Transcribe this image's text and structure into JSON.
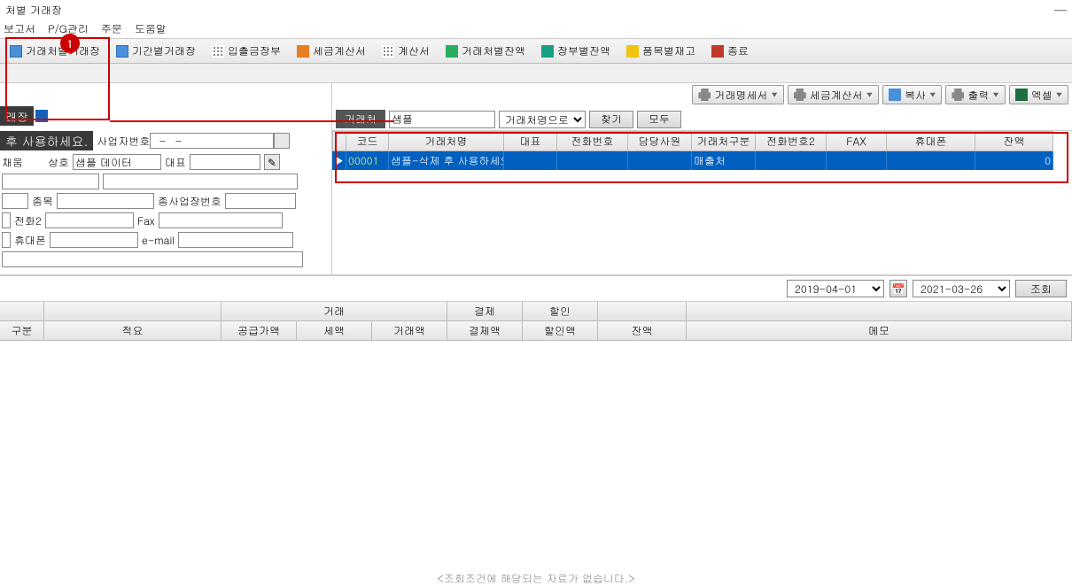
{
  "window": {
    "title": "처별 거래장",
    "minimize": "—"
  },
  "menu": {
    "report": "보고서",
    "pg": "P/G관리",
    "order": "주문",
    "help": "도움말"
  },
  "toolbar": {
    "btn1": "거래처별거래장",
    "btn2": "기간별거래장",
    "btn3": "입출금장부",
    "btn4": "세금계산서",
    "btn5": "계산서",
    "btn6": "거래처별잔액",
    "btn7": "장부별잔액",
    "btn8": "품목별재고",
    "btn9": "종료"
  },
  "badge": "1",
  "left": {
    "tab": "래장",
    "hint": "후 사용하세요.",
    "lbl_bizno": "사업자번호",
    "bizno": "  –   –",
    "lbl_first": "채움",
    "lbl_trade": "상호",
    "trade": "샘플 데이터",
    "lbl_rep": "대표",
    "lbl_item": "종목",
    "lbl_subbiz": "종사업장번호",
    "lbl_tel2": "전화2",
    "lbl_fax": "Fax",
    "lbl_mobile": "휴대폰",
    "lbl_email": "e-mail"
  },
  "actions": {
    "spec": "거래명세서",
    "tax": "세금계산서",
    "copy": "복사",
    "print": "출력",
    "excel": "엑셀"
  },
  "search": {
    "lbl": "거래처",
    "value": "샘플",
    "by": "거래처명으로",
    "find": "찾기",
    "all": "모두"
  },
  "grid": {
    "headers": {
      "h0": "",
      "h1": "코드",
      "h2": "거래처명",
      "h3": "대표",
      "h4": "전화번호",
      "h5": "담당사원",
      "h6": "거래처구분",
      "h7": "전화번호2",
      "h8": "FAX",
      "h9": "휴대폰",
      "h10": "잔액"
    },
    "row": {
      "mark": "▶",
      "code": "00001",
      "name": "샘플-삭제 후 사용하세요",
      "rep": "",
      "tel": "",
      "staff": "",
      "type": "매출처",
      "tel2": "",
      "fax": "",
      "mobile": "",
      "balance": "0"
    }
  },
  "dates": {
    "from": "2019-04-01",
    "to": "2021-03-26",
    "query": "조회"
  },
  "lower": {
    "g1": "거래",
    "g2": "결제",
    "g3": "할인",
    "c1": "구분",
    "c2": "적요",
    "c3": "공급가액",
    "c4": "세액",
    "c5": "거래액",
    "c6": "결제액",
    "c7": "할인액",
    "c8": "잔액",
    "c9": "메모"
  },
  "empty": "<조회조건에 해당되는 자료가 없습니다.>"
}
